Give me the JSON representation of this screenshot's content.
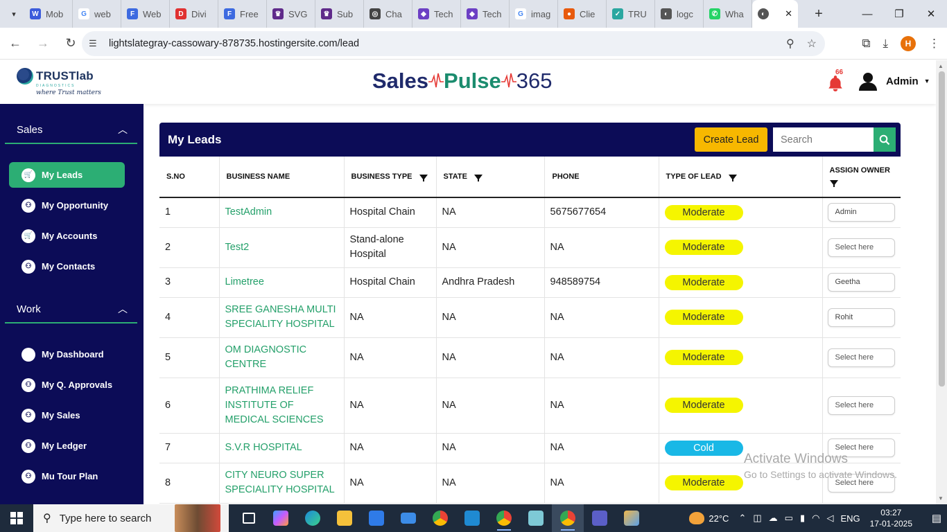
{
  "browser": {
    "tabs": [
      {
        "label": "Mob",
        "color": "#3b5bdb",
        "glyph": "W"
      },
      {
        "label": "web",
        "color": "#ffffff",
        "glyph": "G"
      },
      {
        "label": "Web",
        "color": "#3d6ae0",
        "glyph": "F"
      },
      {
        "label": "Divi",
        "color": "#e03131",
        "glyph": "D"
      },
      {
        "label": "Free",
        "color": "#3d6ae0",
        "glyph": "F"
      },
      {
        "label": "SVG",
        "color": "#5f2a8a",
        "glyph": "♛"
      },
      {
        "label": "Sub",
        "color": "#5f2a8a",
        "glyph": "♛"
      },
      {
        "label": "Cha",
        "color": "#444444",
        "glyph": "◎"
      },
      {
        "label": "Tech",
        "color": "#6c3fc4",
        "glyph": "◆"
      },
      {
        "label": "Tech",
        "color": "#6c3fc4",
        "glyph": "◆"
      },
      {
        "label": "imag",
        "color": "#ffffff",
        "glyph": "G"
      },
      {
        "label": "Clie",
        "color": "#e8590c",
        "glyph": "●"
      },
      {
        "label": "TRU",
        "color": "#2aa7a0",
        "glyph": "✓"
      },
      {
        "label": "logc",
        "color": "#555555",
        "glyph": "◐"
      },
      {
        "label": "Wha",
        "color": "#25d366",
        "glyph": "✆"
      }
    ],
    "url": "lightslategray-cassowary-878735.hostingersite.com/lead",
    "profile_initial": "H"
  },
  "header": {
    "brand": "TRUSTlab",
    "brand_sub": "DIAGNOSTICS",
    "brand_tag": "where Trust matters",
    "title_part1": "Sales",
    "title_part2": "Pulse",
    "title_part3": "365",
    "notification_count": "66",
    "user_name": "Admin"
  },
  "sidebar": {
    "sections": [
      {
        "title": "Sales",
        "items": [
          {
            "label": "My Leads",
            "active": true
          },
          {
            "label": "My Opportunity"
          },
          {
            "label": "My Accounts"
          },
          {
            "label": "My Contacts"
          }
        ]
      },
      {
        "title": "Work",
        "items": [
          {
            "label": "My Dashboard"
          },
          {
            "label": "My Q. Approvals"
          },
          {
            "label": "My Sales"
          },
          {
            "label": "My Ledger"
          },
          {
            "label": "Mu Tour Plan"
          }
        ]
      }
    ]
  },
  "leads": {
    "title": "My Leads",
    "create_label": "Create Lead",
    "search_placeholder": "Search",
    "columns": [
      "S.NO",
      "BUSINESS NAME",
      "BUSINESS TYPE",
      "STATE",
      "PHONE",
      "TYPE OF LEAD",
      "ASSIGN OWNER"
    ],
    "rows": [
      {
        "sno": "1",
        "name": "TestAdmin",
        "type": "Hospital Chain",
        "state": "NA",
        "phone": "5675677654",
        "lead": "Moderate",
        "owner": "Admin"
      },
      {
        "sno": "2",
        "name": "Test2",
        "type": "Stand-alone Hospital",
        "state": "NA",
        "phone": "NA",
        "lead": "Moderate",
        "owner": "Select here"
      },
      {
        "sno": "3",
        "name": "Limetree",
        "type": "Hospital Chain",
        "state": "Andhra Pradesh",
        "phone": "948589754",
        "lead": "Moderate",
        "owner": "Geetha"
      },
      {
        "sno": "4",
        "name": "SREE GANESHA MULTI SPECIALITY HOSPITAL",
        "type": "NA",
        "state": "NA",
        "phone": "NA",
        "lead": "Moderate",
        "owner": "Rohit"
      },
      {
        "sno": "5",
        "name": "OM DIAGNOSTIC CENTRE",
        "type": "NA",
        "state": "NA",
        "phone": "NA",
        "lead": "Moderate",
        "owner": "Select here"
      },
      {
        "sno": "6",
        "name": "PRATHIMA RELIEF INSTITUTE OF MEDICAL SCIENCES",
        "type": "NA",
        "state": "NA",
        "phone": "NA",
        "lead": "Moderate",
        "owner": "Select here"
      },
      {
        "sno": "7",
        "name": "S.V.R HOSPITAL",
        "type": "NA",
        "state": "NA",
        "phone": "NA",
        "lead": "Cold",
        "owner": "Select here"
      },
      {
        "sno": "8",
        "name": "CITY NEURO SUPER SPECIALITY HOSPITAL",
        "type": "NA",
        "state": "NA",
        "phone": "NA",
        "lead": "Moderate",
        "owner": "Select here"
      }
    ]
  },
  "watermark": {
    "line1": "Activate Windows",
    "line2": "Go to Settings to activate Windows."
  },
  "taskbar": {
    "search_placeholder": "Type here to search",
    "weather": "22°C",
    "language": "ENG",
    "time": "03:27",
    "date": "17-01-2025"
  },
  "colors": {
    "navy": "#0c0c57",
    "green": "#2cae74",
    "create": "#f7b800",
    "moderate": "#f5f500",
    "cold": "#19b8e6"
  }
}
